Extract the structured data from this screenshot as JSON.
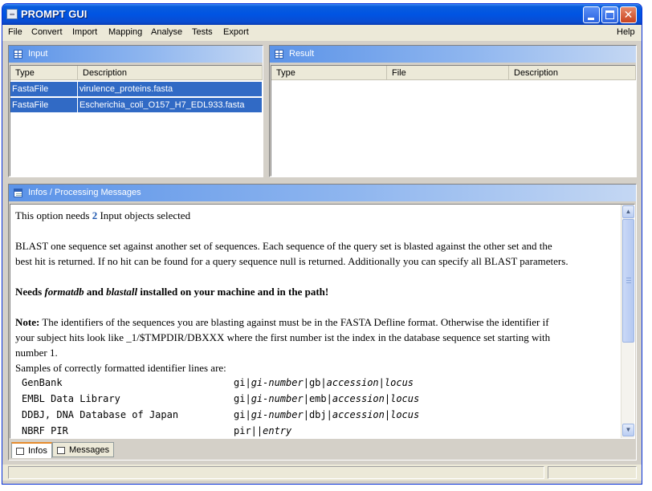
{
  "window": {
    "title": "PROMPT GUI",
    "app_icon": "app-icon",
    "close_glyph": "✕"
  },
  "menu": {
    "left": [
      "File",
      "Convert",
      "Import",
      "Mapping",
      "Analyse",
      "Tests",
      "Export"
    ],
    "right": "Help"
  },
  "input_panel": {
    "title": "Input",
    "icon": "table-icon",
    "columns": [
      "Type",
      "Description"
    ],
    "rows": [
      {
        "type": "FastaFile",
        "description": "virulence_proteins.fasta"
      },
      {
        "type": "FastaFile",
        "description": "Escherichia_coli_O157_H7_EDL933.fasta"
      }
    ]
  },
  "result_panel": {
    "title": "Result",
    "icon": "table-icon",
    "columns": [
      "Type",
      "File",
      "Description"
    ]
  },
  "info_panel": {
    "title": "Infos / Processing Messages",
    "icon": "info-panel-icon",
    "line1_prefix": "This option needs ",
    "line1_count": "2",
    "line1_suffix": " Input objects selected",
    "para1_line1": "BLAST one sequence set against another set of sequences. Each sequence of the query set is blasted against the other set and the",
    "para1_line2": "best hit is returned. If no hit can be found for a query sequence null is returned. Additionally you can specify all BLAST parameters.",
    "needs_prefix": "Needs ",
    "needs_tool1": "formatdb",
    "needs_and": " and ",
    "needs_tool2": "blastall",
    "needs_suffix": " installed on your machine and in the path!",
    "note_label": "Note:",
    "note_line1": " The identifiers of the sequences you are blasting against must be in the FASTA Defline format. Otherwise the identifier if",
    "note_line2": "your subject hits look like _1/$TMPDIR/DBXXX where the first number ist the index in the database sequence set starting with",
    "note_line3": "number 1.",
    "samples_heading": "Samples of correctly formatted identifier lines are:",
    "identifiers": [
      {
        "name": "GenBank",
        "p1": "gi|",
        "i1": "gi-number",
        "p2": "|gb|",
        "i2": "accession",
        "p3": "|",
        "i3": "locus"
      },
      {
        "name": "EMBL Data Library",
        "p1": "gi|",
        "i1": "gi-number",
        "p2": "|emb|",
        "i2": "accession",
        "p3": "|",
        "i3": "locus"
      },
      {
        "name": "DDBJ, DNA Database of Japan",
        "p1": "gi|",
        "i1": "gi-number",
        "p2": "|dbj|",
        "i2": "accession",
        "p3": "|",
        "i3": "locus"
      },
      {
        "name": "NBRF PIR",
        "p1": "pir||",
        "i1": "entry",
        "p2": "",
        "i2": "",
        "p3": "",
        "i3": ""
      }
    ]
  },
  "tabs": {
    "infos": "Infos",
    "messages": "Messages",
    "active": "Infos"
  },
  "scrollbar": {
    "up_glyph": "▲",
    "down_glyph": "▼"
  }
}
